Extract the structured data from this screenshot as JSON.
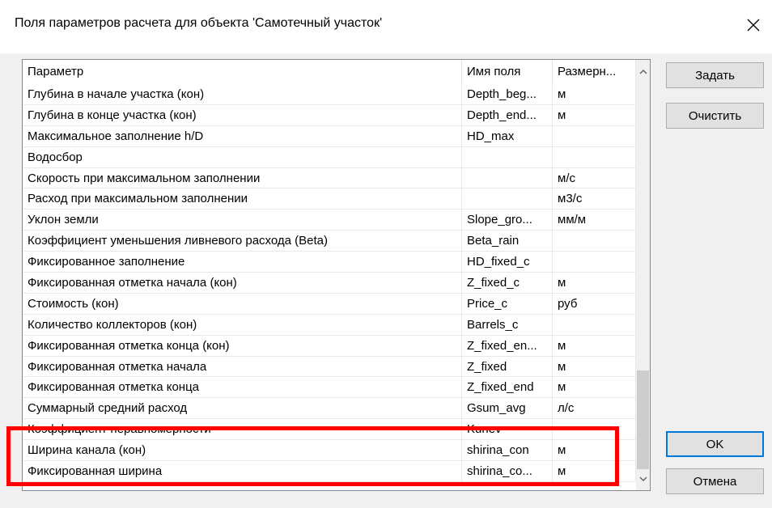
{
  "window": {
    "title": "Поля параметров расчета для объекта 'Самотечный участок'"
  },
  "table": {
    "columns": [
      "Параметр",
      "Имя поля",
      "Размерн..."
    ],
    "rows": [
      [
        "Глубина в начале участка (кон)",
        "Depth_beg...",
        "м"
      ],
      [
        "Глубина в конце участка (кон)",
        "Depth_end...",
        "м"
      ],
      [
        "Максимальное заполнение h/D",
        "HD_max",
        ""
      ],
      [
        "Водосбор",
        "",
        ""
      ],
      [
        "Скорость при максимальном заполнении",
        "",
        "м/с"
      ],
      [
        "Расход при максимальном заполнении",
        "",
        "м3/с"
      ],
      [
        "Уклон земли",
        "Slope_gro...",
        "мм/м"
      ],
      [
        "Коэффициент уменьшения ливневого расхода (Beta)",
        "Beta_rain",
        ""
      ],
      [
        "Фиксированное заполнение",
        "HD_fixed_c",
        ""
      ],
      [
        "Фиксированная отметка начала (кон)",
        "Z_fixed_c",
        "м"
      ],
      [
        "Стоимость (кон)",
        "Price_c",
        "руб"
      ],
      [
        "Количество коллекторов (кон)",
        "Barrels_c",
        ""
      ],
      [
        "Фиксированная отметка конца (кон)",
        "Z_fixed_en...",
        "м"
      ],
      [
        "Фиксированная отметка начала",
        "Z_fixed",
        "м"
      ],
      [
        "Фиксированная отметка конца",
        "Z_fixed_end",
        "м"
      ],
      [
        "Суммарный средний расход",
        "Gsum_avg",
        "л/с"
      ],
      [
        "Коэффициент неравномерности",
        "Kunev",
        ""
      ],
      [
        "Ширина канала (кон)",
        "shirina_con",
        "м"
      ],
      [
        "Фиксированная ширина",
        "shirina_co...",
        "м"
      ]
    ]
  },
  "buttons": {
    "set": "Задать",
    "clear": "Очистить",
    "ok": "OK",
    "cancel": "Отмена"
  },
  "icons": {
    "close": "close-icon",
    "scroll_up": "chevron-up-icon",
    "scroll_down": "chevron-down-icon"
  },
  "colors": {
    "highlight": "#ff0000",
    "default_button_border": "#0078d7"
  }
}
